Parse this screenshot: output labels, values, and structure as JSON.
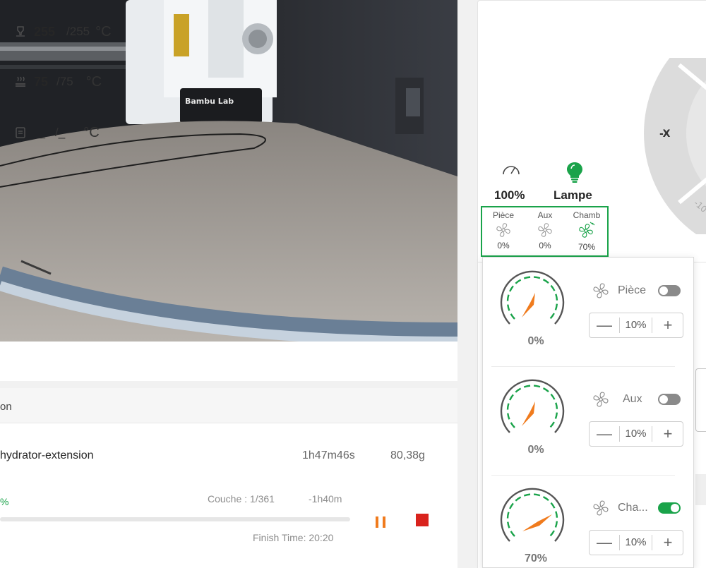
{
  "camera": {
    "brand_text": "Bambu Lab"
  },
  "print": {
    "header_label": "on",
    "job_name": "hydrator-extension",
    "duration": "1h47m46s",
    "weight": "80,38g",
    "percent_label": "%",
    "progress_fraction": 0.0,
    "layer": "Couche : 1/361",
    "remaining": "-1h40m",
    "finish_time": "Finish Time: 20:20"
  },
  "temps": {
    "nozzle": {
      "current": "255",
      "target": "/255",
      "unit": "°C"
    },
    "bed": {
      "current": "75",
      "target": "/75",
      "unit": "°C"
    },
    "chamber": {
      "current": "_",
      "target": "/_",
      "unit": "°C"
    }
  },
  "speed": {
    "value": "100%"
  },
  "lamp": {
    "label": "Lampe"
  },
  "wheel": {
    "x_neg": "-X",
    "step_partial": "-10"
  },
  "fan_tabs": [
    {
      "name": "Pièce",
      "value": "0%"
    },
    {
      "name": "Aux",
      "value": "0%"
    },
    {
      "name": "Chamb",
      "value": "70%"
    }
  ],
  "fans": [
    {
      "name": "Pièce",
      "value": "0%",
      "step": "10%",
      "on": false,
      "minus": "—",
      "plus": "+"
    },
    {
      "name": "Aux",
      "value": "0%",
      "step": "10%",
      "on": false,
      "minus": "—",
      "plus": "+"
    },
    {
      "name": "Cha...",
      "value": "70%",
      "step": "10%",
      "on": true,
      "minus": "—",
      "plus": "+"
    }
  ],
  "colors": {
    "accent": "#1aa34a",
    "pause": "#f07b1d",
    "stop": "#d9231d"
  }
}
